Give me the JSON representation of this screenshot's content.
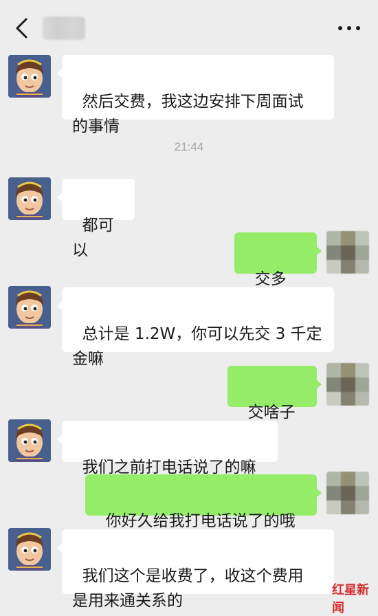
{
  "header": {
    "back_icon": "chevron-left-icon",
    "contact_name": "",
    "more_icon": "more-horizontal-icon"
  },
  "messages": [
    {
      "side": "left",
      "text": "然后交费，我这边安排下周面试\n的事情"
    },
    {
      "side": "left",
      "text": "都可以"
    },
    {
      "side": "right",
      "text": "交多少？"
    },
    {
      "side": "left",
      "text": "总计是 1.2W，你可以先交 3 千定\n金嘛"
    },
    {
      "side": "right",
      "text": "交啥子费"
    },
    {
      "side": "left",
      "text": "我们之前打电话说了的嘛"
    },
    {
      "side": "right",
      "text": "你好久给我打电话说了的哦"
    },
    {
      "side": "left",
      "text": "我们这个是收费了，收这个费用\n是用来通关系的"
    }
  ],
  "timestamp": "21:44",
  "watermark": "红星新闻",
  "colors": {
    "background": "#ededed",
    "bubble_incoming": "#ffffff",
    "bubble_outgoing": "#95ec69",
    "timestamp": "#a4a4a4",
    "watermark": "#d32f2f"
  }
}
